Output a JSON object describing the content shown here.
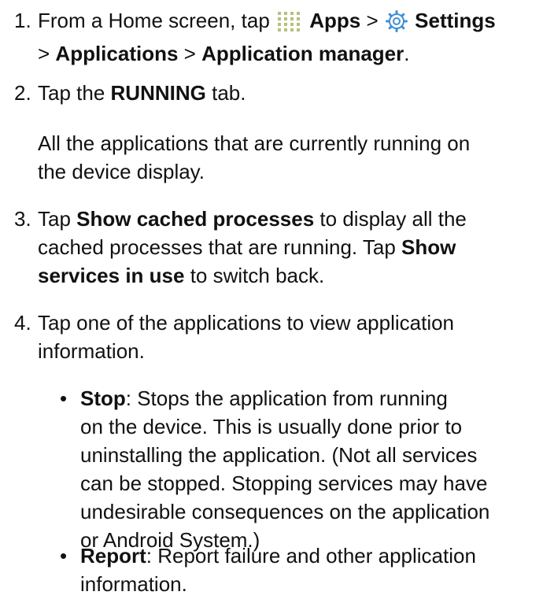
{
  "steps": [
    {
      "num": "1.",
      "line1": {
        "pre": "From a Home screen, tap",
        "apps": "Apps",
        "sep": ">",
        "settings": "Settings"
      },
      "line2": {
        "sep1": ">",
        "applications": "Applications",
        "sep2": ">",
        "app_manager": "Application manager",
        "end": "."
      }
    },
    {
      "num": "2.",
      "pre": "Tap the",
      "bold": "RUNNING",
      "post": "tab.",
      "note_lines": [
        "All the applications that are currently running on",
        "the device display."
      ]
    },
    {
      "num": "3.",
      "l1_pre": "Tap",
      "l1_bold": "Show cached processes",
      "l1_post": "to display all the",
      "l2_pre": "cached processes that are running. Tap",
      "l2_bold": "Show",
      "l3_bold": "services in use",
      "l3_post": "to switch back."
    },
    {
      "num": "4.",
      "lines": [
        "Tap one of the applications to view application",
        "information."
      ]
    }
  ],
  "bullets": [
    {
      "dot": "•",
      "term": "Stop",
      "first_rest": ": Stops the application from running",
      "lines": [
        "on the device. This is usually done prior to",
        "uninstalling the application. (Not all services",
        "can be stopped. Stopping services may have",
        "undesirable consequences on the application",
        "or Android System.)"
      ]
    },
    {
      "dot": "•",
      "term": "Report",
      "first_rest": ": Report failure and other application",
      "lines": [
        "information."
      ]
    }
  ],
  "icons": {
    "apps": "apps-grid-icon",
    "settings": "settings-gear-icon"
  },
  "colors": {
    "text": "#111111",
    "apps_icon": "#b8c07a",
    "settings_icon": "#3f8fd6"
  }
}
